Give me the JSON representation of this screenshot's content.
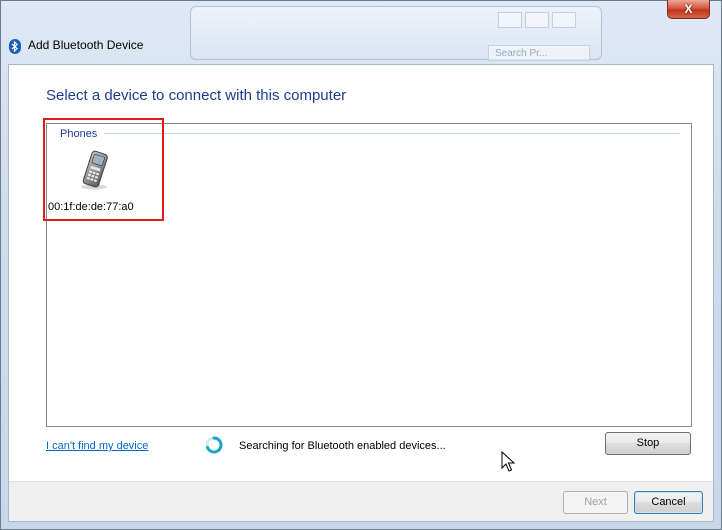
{
  "window": {
    "title": "Add Bluetooth Device",
    "close_glyph": "X",
    "icon": "bluetooth-icon"
  },
  "background_window": {
    "search_placeholder": "Search Pr..."
  },
  "main": {
    "heading": "Select a device to connect with this computer",
    "group_label": "Phones",
    "devices": [
      {
        "name": "00:1f:de:de:77:a0",
        "icon": "mobile-phone-icon"
      }
    ]
  },
  "status": {
    "link_text": "I can't find my device",
    "searching_text": "Searching for Bluetooth enabled devices...",
    "stop_label": "Stop"
  },
  "footer": {
    "next_label": "Next",
    "cancel_label": "Cancel"
  },
  "colors": {
    "heading": "#1e3c8e",
    "link": "#0066cc",
    "highlight": "#e31a1a",
    "close_button": "#c3351c"
  }
}
